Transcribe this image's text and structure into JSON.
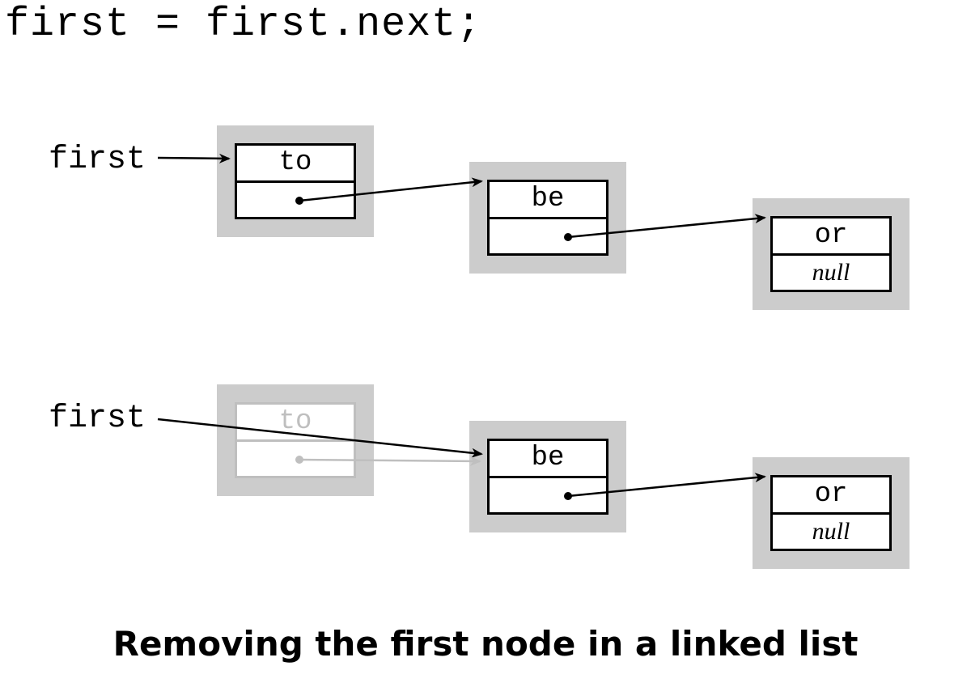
{
  "code": "first = first.next;",
  "caption": "Removing the first node in a linked list",
  "labels": {
    "first_top": "first",
    "first_bottom": "first"
  },
  "nodes": {
    "to": "to",
    "be": "be",
    "or": "or",
    "null": "null"
  },
  "colors": {
    "node_bg": "#cccccc",
    "faded": "#bfbfbf",
    "stroke": "#000000"
  },
  "diagram": {
    "description": "Two states of a three-node linked list (to → be → or/null). Top: pointer 'first' references node 'to'. Bottom: pointer 'first' bypasses faded node 'to' and references node 'be'.",
    "rows": [
      {
        "pointer": "first",
        "pointer_target": "to",
        "nodes": [
          {
            "data": "to",
            "next": "be",
            "faded": false
          },
          {
            "data": "be",
            "next": "or",
            "faded": false
          },
          {
            "data": "or",
            "next": "null",
            "faded": false
          }
        ]
      },
      {
        "pointer": "first",
        "pointer_target": "be",
        "nodes": [
          {
            "data": "to",
            "next": "be",
            "faded": true
          },
          {
            "data": "be",
            "next": "or",
            "faded": false
          },
          {
            "data": "or",
            "next": "null",
            "faded": false
          }
        ]
      }
    ]
  }
}
